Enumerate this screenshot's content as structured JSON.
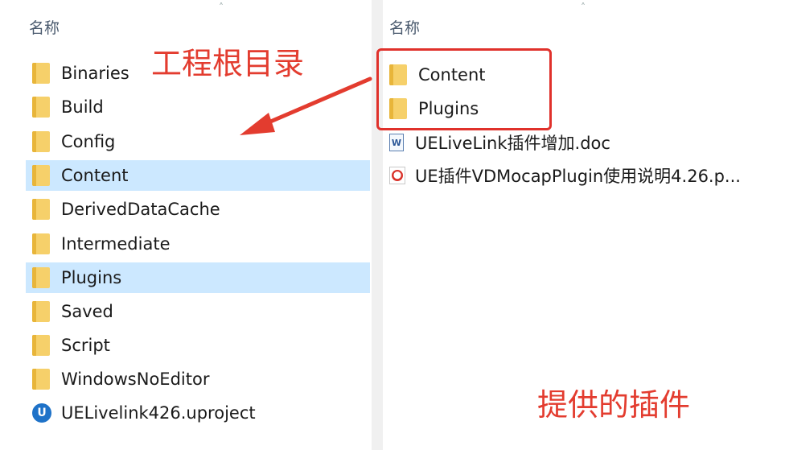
{
  "left_pane": {
    "column_header": "名称",
    "items": [
      {
        "name": "Binaries",
        "icon": "folder-icon",
        "selected": false
      },
      {
        "name": "Build",
        "icon": "folder-icon",
        "selected": false
      },
      {
        "name": "Config",
        "icon": "folder-icon",
        "selected": false
      },
      {
        "name": "Content",
        "icon": "folder-icon",
        "selected": true
      },
      {
        "name": "DerivedDataCache",
        "icon": "folder-icon",
        "selected": false
      },
      {
        "name": "Intermediate",
        "icon": "folder-icon",
        "selected": false
      },
      {
        "name": "Plugins",
        "icon": "folder-icon",
        "selected": true
      },
      {
        "name": "Saved",
        "icon": "folder-icon",
        "selected": false
      },
      {
        "name": "Script",
        "icon": "folder-icon",
        "selected": false
      },
      {
        "name": "WindowsNoEditor",
        "icon": "folder-icon",
        "selected": false
      },
      {
        "name": "UELivelink426.uproject",
        "icon": "unreal-project-icon",
        "selected": false
      }
    ]
  },
  "right_pane": {
    "column_header": "名称",
    "items": [
      {
        "name": "Content",
        "icon": "folder-icon"
      },
      {
        "name": "Plugins",
        "icon": "folder-icon"
      },
      {
        "name": "UELiveLink插件增加.doc",
        "icon": "word-doc-icon"
      },
      {
        "name": "UE插件VDMocapPlugin使用说明4.26.p...",
        "icon": "pdf-icon"
      }
    ]
  },
  "annotations": {
    "project_root": "工程根目录",
    "provided_plugins": "提供的插件",
    "color": "#e33c2f"
  },
  "colors": {
    "selection": "#cce8ff",
    "folder": "#f6d06a"
  }
}
